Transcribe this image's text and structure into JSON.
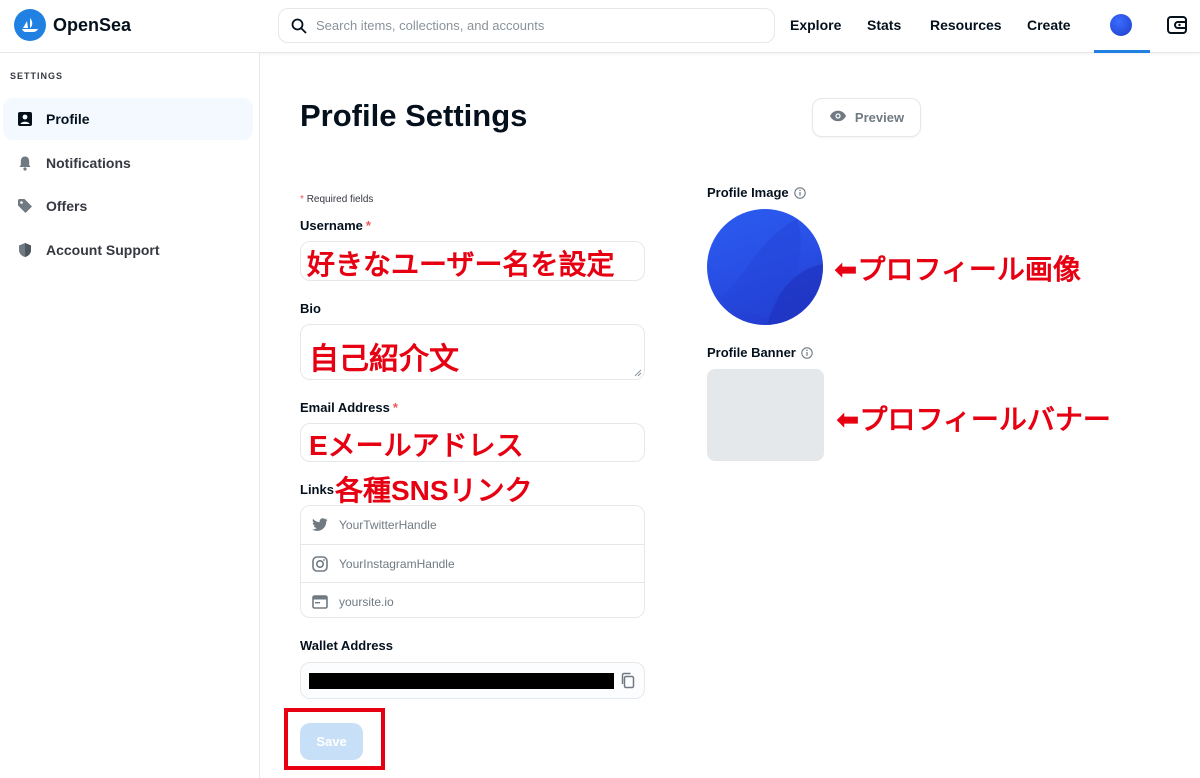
{
  "header": {
    "logo_text": "OpenSea",
    "search_placeholder": "Search items, collections, and accounts",
    "nav": [
      "Explore",
      "Stats",
      "Resources",
      "Create"
    ]
  },
  "sidebar": {
    "heading": "SETTINGS",
    "items": [
      {
        "label": "Profile",
        "icon": "profile-icon",
        "active": true
      },
      {
        "label": "Notifications",
        "icon": "bell-icon",
        "active": false
      },
      {
        "label": "Offers",
        "icon": "tag-icon",
        "active": false
      },
      {
        "label": "Account Support",
        "icon": "shield-icon",
        "active": false
      }
    ]
  },
  "main": {
    "title": "Profile Settings",
    "preview_label": "Preview",
    "required_note": "Required fields",
    "required_star": "*",
    "username_label": "Username",
    "bio_label": "Bio",
    "email_label": "Email Address",
    "links_label": "Links",
    "links": [
      {
        "placeholder": "YourTwitterHandle",
        "icon": "twitter-icon"
      },
      {
        "placeholder": "YourInstagramHandle",
        "icon": "instagram-icon"
      },
      {
        "placeholder": "yoursite.io",
        "icon": "website-icon"
      }
    ],
    "wallet_label": "Wallet Address",
    "save_label": "Save",
    "profile_image_label": "Profile Image",
    "profile_banner_label": "Profile Banner"
  },
  "annotations": {
    "username": "好きなユーザー名を設定",
    "bio": "自己紹介文",
    "email": "Eメールアドレス",
    "links": "各種SNSリンク",
    "profile_image": "⬅プロフィール画像",
    "profile_banner": "⬅プロフィールバナー"
  },
  "colors": {
    "accent": "#2081e2",
    "annotation_red": "#e60012",
    "save_disabled": "#c8e0f7"
  }
}
